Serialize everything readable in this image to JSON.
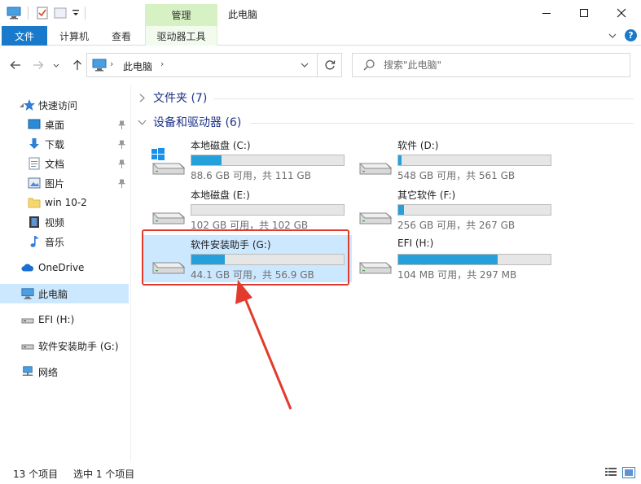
{
  "window": {
    "title": "此电脑",
    "contextual_group": "管理"
  },
  "ribbon": {
    "tabs": [
      "文件",
      "计算机",
      "查看",
      "驱动器工具"
    ]
  },
  "address": {
    "path": "此电脑",
    "search_placeholder": "搜索\"此电脑\""
  },
  "sidebar": {
    "quick_access": "快速访问",
    "items": [
      {
        "label": "桌面",
        "icon": "desktop-icon",
        "pinned": true
      },
      {
        "label": "下载",
        "icon": "download-icon",
        "pinned": true
      },
      {
        "label": "文档",
        "icon": "document-icon",
        "pinned": true
      },
      {
        "label": "图片",
        "icon": "picture-icon",
        "pinned": true
      },
      {
        "label": "win 10-2",
        "icon": "folder-icon",
        "pinned": false
      },
      {
        "label": "视频",
        "icon": "video-icon",
        "pinned": false
      },
      {
        "label": "音乐",
        "icon": "music-icon",
        "pinned": false
      }
    ],
    "onedrive": "OneDrive",
    "this_pc": "此电脑",
    "efi": "EFI (H:)",
    "usb": "软件安装助手 (G:)",
    "network": "网络"
  },
  "main": {
    "folders_header": "文件夹 (7)",
    "devices_header": "设备和驱动器 (6)",
    "drives": [
      {
        "name": "本地磁盘 (C:)",
        "size": "88.6 GB 可用，共 111 GB",
        "used_fraction": 0.2,
        "os": true,
        "selected": false
      },
      {
        "name": "软件 (D:)",
        "size": "548 GB 可用，共 561 GB",
        "used_fraction": 0.02,
        "os": false,
        "selected": false
      },
      {
        "name": "本地磁盘 (E:)",
        "size": "102 GB 可用，共 102 GB",
        "used_fraction": 0.0,
        "os": false,
        "selected": false
      },
      {
        "name": "其它软件 (F:)",
        "size": "256 GB 可用，共 267 GB",
        "used_fraction": 0.04,
        "os": false,
        "selected": false
      },
      {
        "name": "软件安装助手 (G:)",
        "size": "44.1 GB 可用，共 56.9 GB",
        "used_fraction": 0.22,
        "os": false,
        "selected": true
      },
      {
        "name": "EFI (H:)",
        "size": "104 MB 可用，共 297 MB",
        "used_fraction": 0.65,
        "os": false,
        "selected": false
      }
    ]
  },
  "status": {
    "count": "13 个项目",
    "selected": "选中 1 个项目"
  },
  "colors": {
    "accent": "#1979ca",
    "selection": "#cce8ff",
    "bar_fill": "#26a0da",
    "annotation": "#e23b2e",
    "contextual_tab": "#d6f1c3"
  }
}
